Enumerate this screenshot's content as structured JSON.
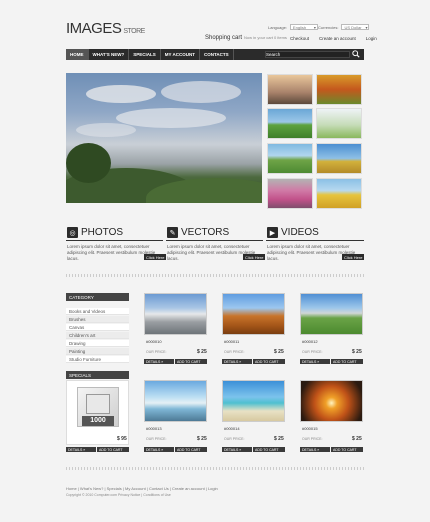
{
  "header": {
    "logo_main": "IMAGES",
    "logo_sub": "STORE",
    "language_label": "Language:",
    "language_value": "English",
    "currencies_label": "Currencies:",
    "currencies_value": "US Dollar",
    "cart_label": "Shopping cart",
    "cart_items": "Now in your cart 0 items",
    "links": [
      "Checkout",
      "Create an account",
      "Login"
    ]
  },
  "nav": {
    "items": [
      "HOME",
      "WHAT'S NEW?",
      "SPECIALS",
      "MY ACCOUNT",
      "CONTACTS"
    ],
    "search_label": "Search"
  },
  "categories_strip": [
    {
      "title": "PHOTOS",
      "icon": "camera-icon",
      "text": "Lorem ipsum dolor sit amet, consectetuer adipiscing elit. Praesent vestibulum molestie lacus.",
      "more": "Click Here"
    },
    {
      "title": "VECTORS",
      "icon": "pen-icon",
      "text": "Lorem ipsum dolor sit amet, consectetuer adipiscing elit. Praesent vestibulum molestie lacus.",
      "more": "Click Here"
    },
    {
      "title": "VIDEOS",
      "icon": "film-icon",
      "text": "Lorem ipsum dolor sit amet, consectetuer adipiscing elit. Praesent vestibulum molestie lacus.",
      "more": "Click Here"
    }
  ],
  "sidebar": {
    "category_title": "CATEGORY",
    "categories": [
      "Books and Videos",
      "Brushes",
      "Canvas",
      "Children's art",
      "Drawing",
      "Painting",
      "Studio Furniture"
    ],
    "specials_title": "SPECIALS",
    "special_badge": "1000",
    "special_price": "$ 95",
    "special_details": "DETAILS »",
    "special_add": "ADD TO CART"
  },
  "products": [
    {
      "name": "#000010",
      "price_label": "OUR PRICE:",
      "price": "$ 25",
      "details": "DETAILS »",
      "add": "ADD TO CART"
    },
    {
      "name": "#000011",
      "price_label": "OUR PRICE:",
      "price": "$ 25",
      "details": "DETAILS »",
      "add": "ADD TO CART"
    },
    {
      "name": "#000012",
      "price_label": "OUR PRICE:",
      "price": "$ 25",
      "details": "DETAILS »",
      "add": "ADD TO CART"
    },
    {
      "name": "#000013",
      "price_label": "OUR PRICE:",
      "price": "$ 25",
      "details": "DETAILS »",
      "add": "ADD TO CART"
    },
    {
      "name": "#000014",
      "price_label": "OUR PRICE:",
      "price": "$ 25",
      "details": "DETAILS »",
      "add": "ADD TO CART"
    },
    {
      "name": "#000015",
      "price_label": "OUR PRICE:",
      "price": "$ 25",
      "details": "DETAILS »",
      "add": "ADD TO CART"
    }
  ],
  "footer": {
    "links": "Home  |  What's New?  |  Specials  |  My Account  |  Contact Us  |  Create an account  |  Login",
    "copyright": "Copyright © 2010 Computer.com      Privacy Notice  |  Conditions of Use"
  },
  "colors": {
    "nav_bg": "#2b2b2b",
    "accent": "#444444"
  }
}
